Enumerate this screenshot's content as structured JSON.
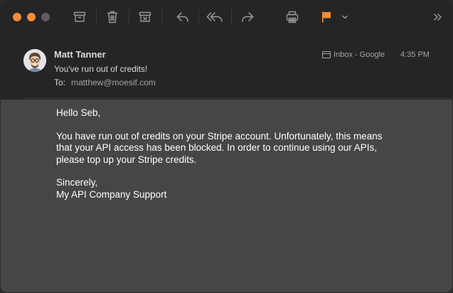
{
  "toolbar": {
    "buttons": [
      {
        "name": "archive-icon"
      },
      {
        "name": "trash-icon"
      },
      {
        "name": "junk-icon"
      },
      {
        "name": "reply-icon"
      },
      {
        "name": "reply-all-icon"
      },
      {
        "name": "forward-icon"
      },
      {
        "name": "print-icon"
      },
      {
        "name": "flag-icon",
        "color": "#f28c3a"
      }
    ],
    "chevron": "chevron-down-icon",
    "overflow": "overflow-chevron-icon"
  },
  "message": {
    "sender": "Matt Tanner",
    "subject": "You've run out of credits!",
    "to_label": "To:",
    "to_value": "matthew@moesif.com",
    "mailbox": "Inbox - Google",
    "time": "4:35 PM"
  },
  "body": {
    "greeting": "Hello Seb,",
    "line1": "You have run out of credits on your Stripe account. Unfortunately, this means",
    "line2": "that your API access has been blocked. In order to continue using our APIs,",
    "line3": "please top up your Stripe credits.",
    "closing": "Sincerely,",
    "signature": "My API Company Support"
  },
  "colors": {
    "accent": "#f28c3a",
    "header_bg": "#252527",
    "body_bg": "#464646"
  }
}
